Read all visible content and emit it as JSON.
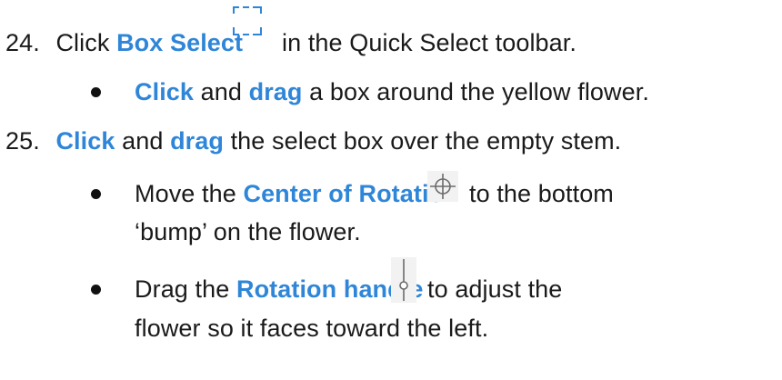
{
  "step24": {
    "number": "24.",
    "pre": "Click ",
    "keyword": "Box Select",
    "post": "in the Quick Select toolbar.",
    "icon": "box-select-icon"
  },
  "step24_bullet": {
    "kw1": "Click",
    "mid": " and ",
    "kw2": "drag",
    "post": " a box around the yellow flower."
  },
  "step25": {
    "number": "25.",
    "kw1": "Click",
    "mid": " and ",
    "kw2": "drag",
    "post": " the select box over the empty stem."
  },
  "step25_bullet1": {
    "pre": "Move the ",
    "keyword": "Center of Rotation",
    "post": "to the bottom",
    "line2": "‘bump’ on the flower.",
    "icon": "center-of-rotation-icon"
  },
  "step25_bullet2": {
    "pre": "Drag the ",
    "keyword": "Rotation handle",
    "post": "to adjust the",
    "line2": "flower so it faces toward the left.",
    "icon": "rotation-handle-icon"
  },
  "colors": {
    "keyword": "#2f86d8",
    "text": "#1a1a1a",
    "icon": "#2f86d8"
  }
}
